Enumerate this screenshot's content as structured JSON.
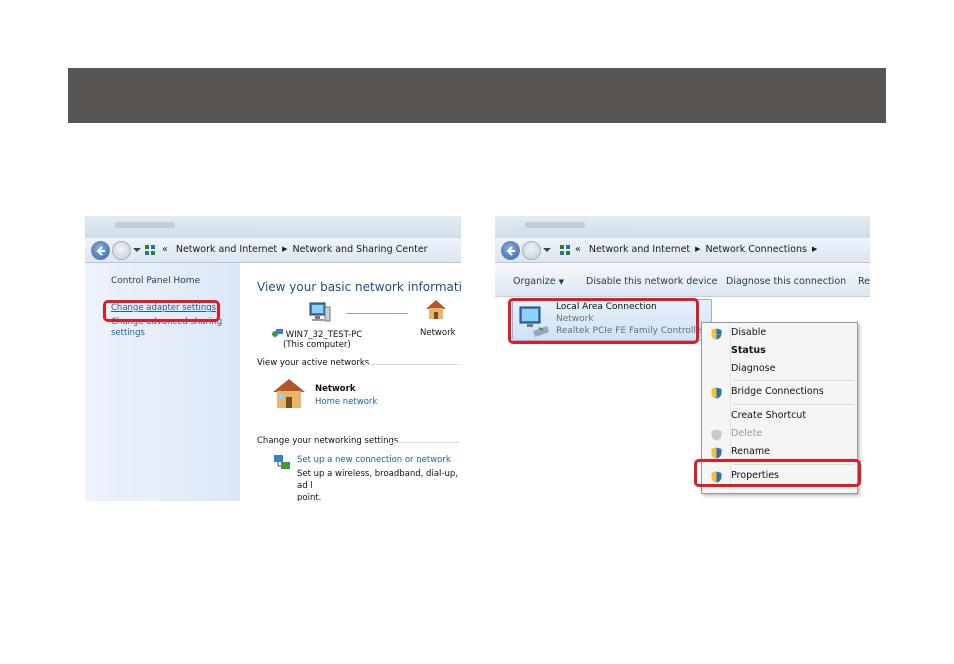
{
  "colors": {
    "banner": "#585553",
    "highlight": "#e01b24",
    "link": "#1a5fa8",
    "heading": "#1e4e8c"
  },
  "left_window": {
    "breadcrumbs": [
      "«",
      "Network and Internet",
      "Network and Sharing Center"
    ],
    "sidebar": {
      "home": "Control Panel Home",
      "change_adapter": "Change adapter settings",
      "advanced_line1": "Change advanced sharing",
      "advanced_line2": "settings"
    },
    "main": {
      "heading": "View your basic network information ar",
      "computer_name": "WIN7_32_TEST-PC",
      "computer_sub": "(This computer)",
      "network_label": "Network",
      "active_title": "View your active networks",
      "active_name": "Network",
      "active_type": "Home network",
      "settings_title": "Change your networking settings",
      "setup_link": "Set up a new connection or network",
      "setup_desc_1": "Set up a wireless, broadband, dial-up, ad l",
      "setup_desc_2": "point."
    },
    "icons": [
      "back-arrow-icon",
      "forward-arrow-icon",
      "network-icon",
      "computer-icon",
      "house-icon",
      "setup-network-icon"
    ]
  },
  "right_window": {
    "breadcrumbs": [
      "«",
      "Network and Internet",
      "Network Connections"
    ],
    "toolbar": {
      "organize": "Organize",
      "disable": "Disable this network device",
      "diagnose": "Diagnose this connection",
      "more": "Re"
    },
    "connection": {
      "name": "Local Area Connection",
      "status": "Network",
      "adapter": "Realtek PCIe FE Family Controller"
    },
    "menu": {
      "disable": "Disable",
      "status": "Status",
      "diagnose": "Diagnose",
      "bridge": "Bridge Connections",
      "shortcut": "Create Shortcut",
      "delete": "Delete",
      "rename": "Rename",
      "properties": "Properties"
    },
    "icons": [
      "network-adapter-icon",
      "shield-icon"
    ]
  }
}
